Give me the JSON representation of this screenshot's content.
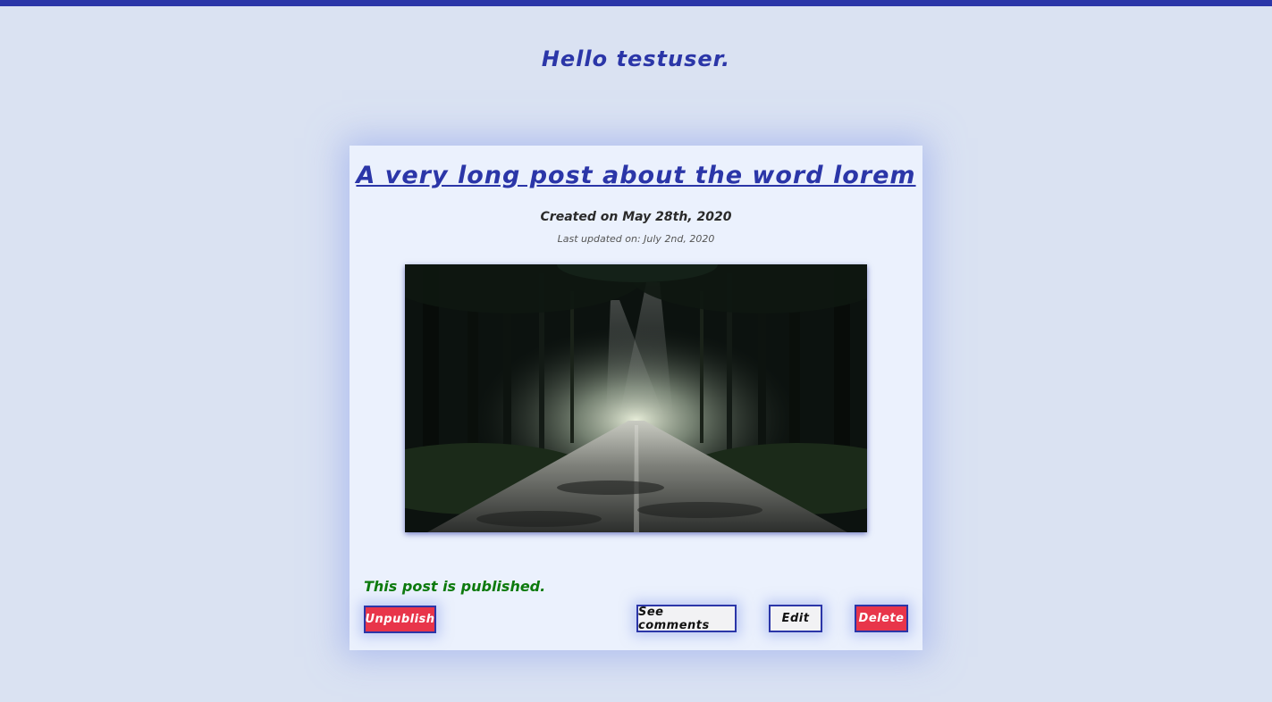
{
  "header": {
    "greeting": "Hello testuser."
  },
  "post": {
    "title": "A very long post about the word lorem",
    "created": "Created on May 28th, 2020",
    "updated": "Last updated on: July 2nd, 2020",
    "image_description": "Forest road with sunlight",
    "status": "This post is published."
  },
  "actions": {
    "unpublish_label": "Unpublish",
    "see_comments_label": "See comments",
    "edit_label": "Edit",
    "delete_label": "Delete"
  },
  "colors": {
    "accent": "#2b36a8",
    "background": "#dae2f2",
    "card": "#ebf1fd",
    "danger": "#e8354a",
    "success": "#0d7a0d"
  }
}
